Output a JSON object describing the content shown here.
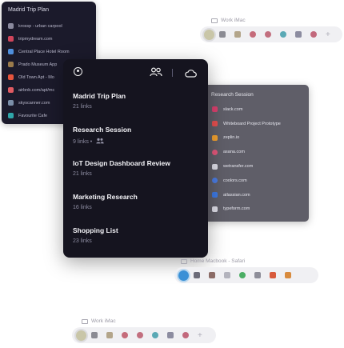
{
  "mini_session": {
    "title": "Madrid Trip Plan",
    "tabs": [
      {
        "label": "krossp - urban carpool",
        "color": "#8a8a9e"
      },
      {
        "label": "tripmydream.com",
        "color": "#d0455b"
      },
      {
        "label": "Central Place Hotel Room",
        "color": "#4f8fdc"
      },
      {
        "label": "Prado Museum App",
        "color": "#9b7b4b"
      },
      {
        "label": "Old Town Apt - Mo",
        "color": "#e6553d"
      },
      {
        "label": "airbnb.com/apt/mc",
        "color": "#e25b62"
      },
      {
        "label": "skyscanner.com",
        "color": "#7b8fa8"
      },
      {
        "label": "Favourite Cafe",
        "color": "#2fa6a9"
      }
    ]
  },
  "main": {
    "sessions": [
      {
        "name": "Madrid Trip Plan",
        "count": "21 links",
        "shared": false
      },
      {
        "name": "Research Session",
        "count": "9 links •",
        "shared": true
      },
      {
        "name": "IoT Design Dashboard Review",
        "count": "21 links",
        "shared": false
      },
      {
        "name": "Marketing Research",
        "count": "16 links",
        "shared": false
      },
      {
        "name": "Shopping List",
        "count": "23 links",
        "shared": false
      }
    ]
  },
  "research_session": {
    "title": "Research Session",
    "tabs": [
      {
        "label": "slack.com",
        "color": "#d9416e"
      },
      {
        "label": "Whiteboard Project Prototype",
        "color": "#e44f4f"
      },
      {
        "label": "zeplin.io",
        "color": "#f0a030"
      },
      {
        "label": "asana.com",
        "color": "#e0577a"
      },
      {
        "label": "wetransfer.com",
        "color": "#dcdce6"
      },
      {
        "label": "coolors.com",
        "color": "#4a7be0"
      },
      {
        "label": "atlassian.com",
        "color": "#3d78e0"
      },
      {
        "label": "typeform.com",
        "color": "#dcdce6"
      }
    ]
  },
  "devices": [
    {
      "label": "Work iMac",
      "active_color": "#c9c6a8",
      "icons": [
        "#8b8b93",
        "#b3a58a",
        "#c56b7a",
        "#c26f7f",
        "#5aa9b5",
        "#8c8ca0",
        "#c2687c"
      ]
    },
    {
      "label": "Home Macbook - Safari",
      "active_color": "#3a90d6",
      "icons": [
        "#6b6b78",
        "#8b6b66",
        "#b3b3bd",
        "#4bae64",
        "#8e8e99",
        "#d85a3c",
        "#d88b3e"
      ]
    },
    {
      "label": "Work iMac",
      "active_color": "#c9c6a8",
      "icons": [
        "#8b8b93",
        "#b3a58a",
        "#c56b7a",
        "#c26f7f",
        "#5aa9b5",
        "#8c8ca0",
        "#c2687c"
      ]
    }
  ]
}
